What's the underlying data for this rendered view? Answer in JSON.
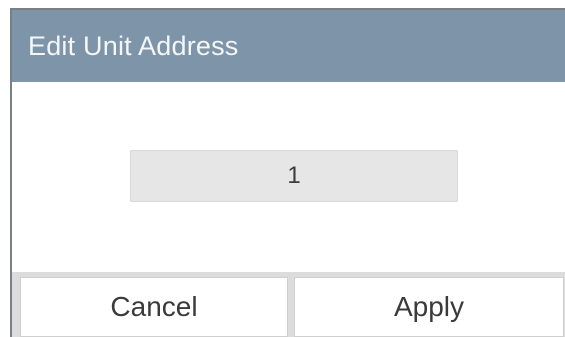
{
  "dialog": {
    "title": "Edit Unit Address",
    "value": "1"
  },
  "buttons": {
    "cancel_label": "Cancel",
    "apply_label": "Apply"
  },
  "colors": {
    "title_bar": "#7e94a8",
    "field_background": "#e6e6e6",
    "button_bar": "#dcdcdc"
  }
}
